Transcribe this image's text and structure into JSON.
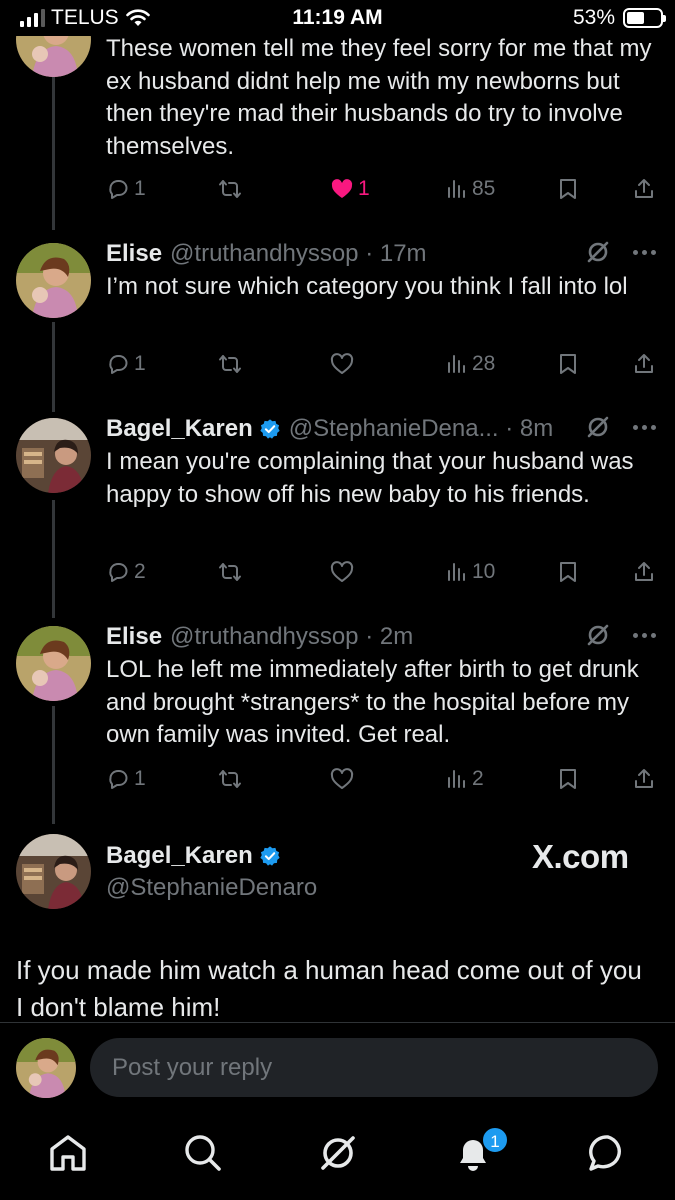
{
  "status_bar": {
    "carrier": "TELUS",
    "time": "11:19 AM",
    "battery": "53%",
    "battery_level": 0.53
  },
  "tweets": [
    {
      "text": "These women tell me they feel sorry for me that my ex husband didnt help me with my newborns but then they're mad their husbands do try to involve themselves.",
      "replies": "1",
      "reposts": "",
      "likes": "1",
      "views": "85",
      "liked": true
    },
    {
      "name": "Elise",
      "handle": "@truthandhyssop",
      "time": "17m",
      "text": "I’m not sure which category you think I fall into lol",
      "replies": "1",
      "reposts": "",
      "likes": "",
      "views": "28",
      "liked": false
    },
    {
      "name": "Bagel_Karen",
      "handle": "@StephanieDena...",
      "time": "8m",
      "text": "I mean you're complaining that your husband was happy to show off his new baby to his friends.",
      "replies": "2",
      "reposts": "",
      "likes": "",
      "views": "10",
      "liked": false
    },
    {
      "name": "Elise",
      "handle": "@truthandhyssop",
      "time": "2m",
      "text": "LOL he left me immediately after birth to get drunk and brought *strangers* to the hospital before my own family was invited. Get real.",
      "replies": "1",
      "reposts": "",
      "likes": "",
      "views": "2",
      "liked": false
    }
  ],
  "main_tweet": {
    "name": "Bagel_Karen",
    "handle": "@StephanieDenaro",
    "text": "If you made him watch a human head come out of you I don't blame him!"
  },
  "watermark": "X.com",
  "reply": {
    "placeholder": "Post your reply"
  },
  "tabbar": {
    "notifications_badge": "1"
  },
  "colors": {
    "background": "#000000",
    "accent": "#1d9bf0",
    "like": "#f91880",
    "muted": "#71767b"
  }
}
